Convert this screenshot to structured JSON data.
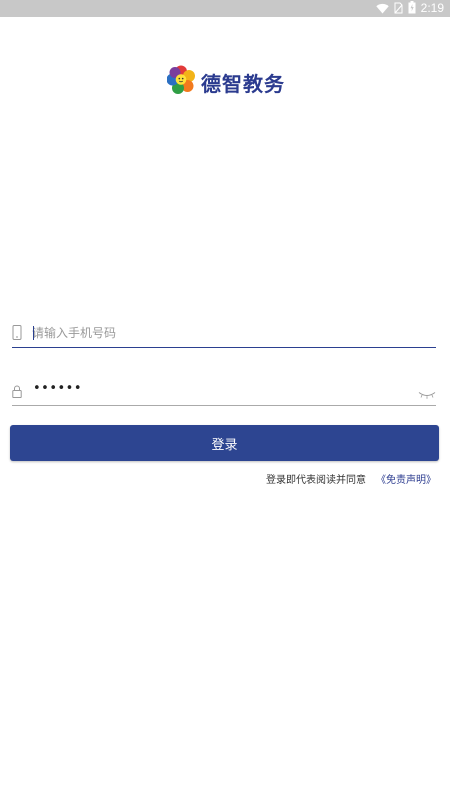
{
  "status_bar": {
    "time": "2:19",
    "icons": [
      "wifi-icon",
      "no-sim-icon",
      "battery-charging-icon"
    ]
  },
  "app": {
    "name": "德智教务",
    "logo_icon": "flower-logo-icon"
  },
  "form": {
    "phone": {
      "placeholder": "请输入手机号码",
      "value": "",
      "icon": "phone-icon"
    },
    "password": {
      "masked_value": "••••••",
      "icon": "lock-icon",
      "toggle_icon": "eye-closed-icon"
    },
    "login_label": "登录",
    "agreement_text": "登录即代表阅读并同意",
    "disclaimer_link": "《免责声明》"
  },
  "colors": {
    "primary": "#2d4591",
    "brand_text": "#2b3b8f",
    "status_bar": "#c8c8c8"
  }
}
